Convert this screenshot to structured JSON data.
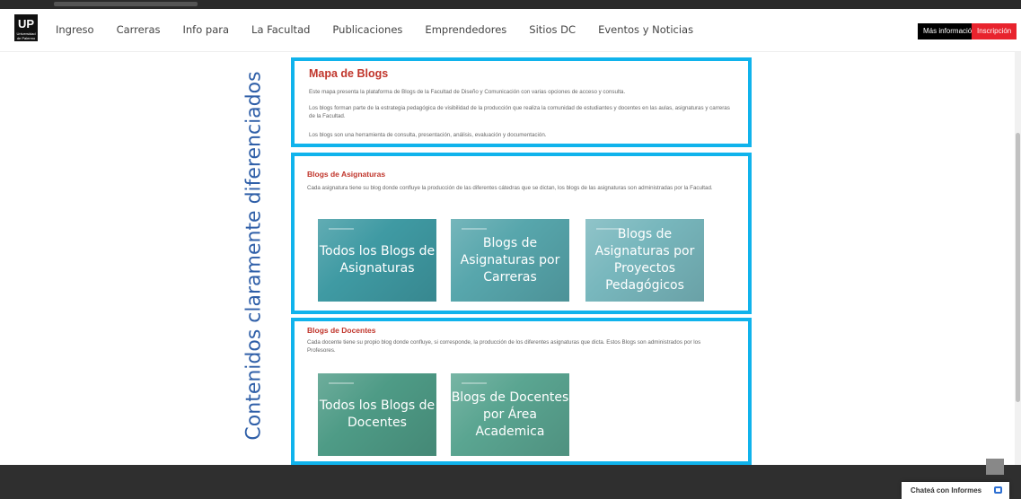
{
  "header": {
    "logo_text": "UP",
    "logo_sub": "Universidad de Palermo",
    "nav": [
      "Ingreso",
      "Carreras",
      "Info para",
      "La Facultad",
      "Publicaciones",
      "Emprendedores",
      "Sitios DC",
      "Eventos y Noticias"
    ],
    "btn_info": "Más información",
    "btn_inscripcion": "Inscripción"
  },
  "annotation": "Contenidos claramente diferenciados",
  "section1": {
    "title": "Mapa de Blogs",
    "p1": "Este mapa presenta la plataforma de Blogs de la Facultad de Diseño y Comunicación con varias opciones de acceso y consulta.",
    "p2": "Los blogs forman parte de la estrategia pedagógica de visibilidad de la producción que realiza la comunidad de estudiantes y docentes en las aulas, asignaturas y carreras de la Facultad.",
    "p3": "Los blogs son una herramienta de consulta, presentación, análisis, evaluación y documentación."
  },
  "section2": {
    "title": "Blogs de Asignaturas",
    "p1": "Cada asignatura tiene su blog donde confluye la producción de las diferentes cátedras que se dictan, los blogs de las asignaturas son administradas por la Facultad.",
    "tiles": [
      "Todos los Blogs de Asignaturas",
      "Blogs de Asignaturas por Carreras",
      "Blogs de Asignaturas por Proyectos Pedagógicos"
    ]
  },
  "section3": {
    "title": "Blogs de Docentes",
    "p1": "Cada docente tiene su propio blog donde confluye, si corresponde, la producción de los diferentes asignaturas que dicta. Estos Blogs son administrados por los Profesores.",
    "tiles": [
      "Todos los Blogs de Docentes",
      "Blogs de Docentes por Área Academica"
    ]
  },
  "chat": {
    "label": "Chateá con Informes"
  },
  "colors": {
    "accent_border": "#10b3ec",
    "title_red": "#c0352b",
    "annotation_blue": "#2f5fa8",
    "btn_red": "#e8232d"
  }
}
